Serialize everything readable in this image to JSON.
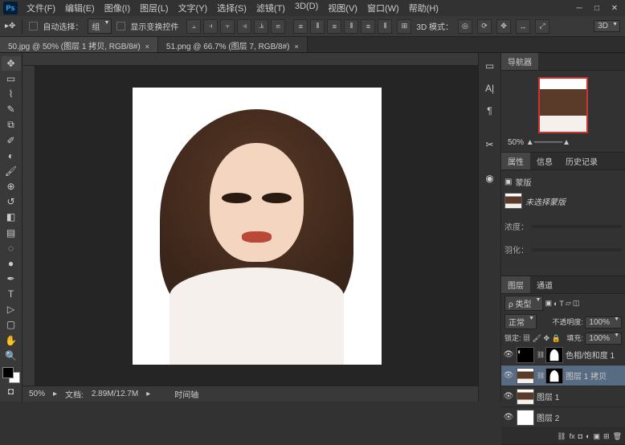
{
  "menu": [
    "文件(F)",
    "编辑(E)",
    "图像(I)",
    "图层(L)",
    "文字(Y)",
    "选择(S)",
    "滤镜(T)",
    "3D(D)",
    "视图(V)",
    "窗口(W)",
    "帮助(H)"
  ],
  "options": {
    "auto_select": "自动选择：",
    "auto_select_mode": "组",
    "transform_controls": "显示变换控件",
    "mode_3d_label": "3D 模式：",
    "mode_3d": "3D"
  },
  "tabs": [
    {
      "label": "50.jpg @ 50% (图层 1 拷贝, RGB/8#)",
      "active": true
    },
    {
      "label": "51.png @ 66.7% (图层 7, RGB/8#)",
      "active": false
    }
  ],
  "status": {
    "zoom": "50%",
    "doc_label": "文档:",
    "doc_size": "2.89M/12.7M",
    "time_label": "时间轴"
  },
  "navigator": {
    "tab": "导航器",
    "zoom": "50%"
  },
  "properties": {
    "tabs": [
      "属性",
      "信息",
      "历史记录"
    ],
    "title": "蒙版",
    "subtitle": "未选择蒙版",
    "density_label": "浓度：",
    "feather_label": "羽化："
  },
  "layers": {
    "tabs": [
      "图层",
      "通道"
    ],
    "kind_label": "ρ 类型",
    "blend_mode": "正常",
    "opacity_label": "不透明度:",
    "opacity": "100%",
    "lock_label": "锁定:",
    "fill_label": "填充:",
    "fill": "100%",
    "items": [
      {
        "name": "色相/饱和度 1",
        "selected": false,
        "adjustment": true
      },
      {
        "name": "图层 1 拷贝",
        "selected": true
      },
      {
        "name": "图层 1",
        "selected": false
      },
      {
        "name": "图层 2",
        "selected": false,
        "white": true
      }
    ]
  }
}
